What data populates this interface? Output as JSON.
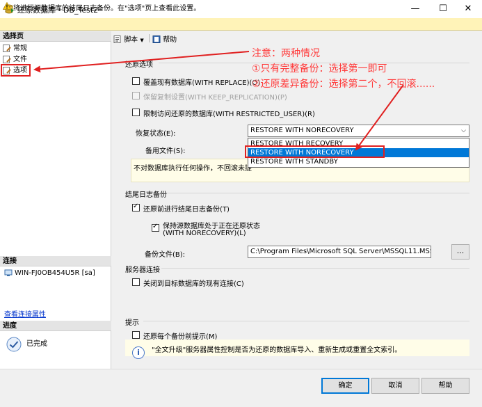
{
  "window": {
    "title": "还原数据库 - DB_Test2",
    "minimize": "—",
    "maximize": "☐",
    "close": "✕"
  },
  "warning": {
    "text": "将进行源数据库的结尾日志备份。在\"选项\"页上查看此设置。",
    "icon": "warning-icon"
  },
  "left": {
    "select_page_header": "选择页",
    "pages": [
      "常规",
      "文件",
      "选项"
    ],
    "connection_header": "连接",
    "server": "WIN-FJ0OB454U5R [sa]",
    "view_connection_link": "查看连接属性",
    "progress_header": "进度",
    "progress_status": "已完成"
  },
  "toolbar": {
    "script_label": "脚本",
    "help_label": "帮助"
  },
  "restore_options": {
    "header": "还原选项",
    "replace": {
      "label": "覆盖现有数据库(WITH REPLACE)(O)",
      "checked": false
    },
    "keep_replication": {
      "label": "保留复制设置(WITH KEEP_REPLICATION)(P)",
      "checked": false,
      "disabled": true
    },
    "restricted_user": {
      "label": "限制访问还原的数据库(WITH RESTRICTED_USER)(R)",
      "checked": false
    },
    "recovery_state_label": "恢复状态(E):",
    "recovery_state_value": "RESTORE WITH NORECOVERY",
    "recovery_options": [
      "RESTORE WITH RECOVERY",
      "RESTORE WITH NORECOVERY",
      "RESTORE WITH STANDBY"
    ],
    "selected_index": 1,
    "standby_file_label": "备用文件(S):",
    "description": "不对数据库执行任何操作，不回滚未提"
  },
  "tail_log": {
    "header": "结尾日志备份",
    "take_tail": {
      "label": "还原前进行结尾日志备份(T)",
      "checked": true
    },
    "leave_norecovery": {
      "label_line1": "保持源数据库处于正在还原状态",
      "label_line2": "(WITH NORECOVERY)(L)",
      "checked": true
    },
    "backup_file_label": "备份文件(B):",
    "backup_file_value": "C:\\Program Files\\Microsoft SQL Server\\MSSQL11.MSSC",
    "browse_label": "..."
  },
  "server_connections": {
    "header": "服务器连接",
    "close_existing": {
      "label": "关闭到目标数据库的现有连接(C)",
      "checked": false
    }
  },
  "prompt": {
    "header": "提示",
    "prompt_each": {
      "label": "还原每个备份前提示(M)",
      "checked": false
    },
    "info_text": "\"全文升级\"服务器属性控制是否为还原的数据库导入、重新生成或重置全文索引。"
  },
  "buttons": {
    "ok": "确定",
    "cancel": "取消",
    "help": "帮助"
  },
  "annotation": {
    "line1": "注意：两种情况",
    "line2": "①只有完整备份：选择第一即可",
    "line3": "②还原差异备份：选择第二个，不回滚......"
  },
  "colors": {
    "annotation_red": "#ff3b3b",
    "selection_blue": "#0078d7",
    "warning_bg": "#fff3b8",
    "link_blue": "#0033cc"
  }
}
